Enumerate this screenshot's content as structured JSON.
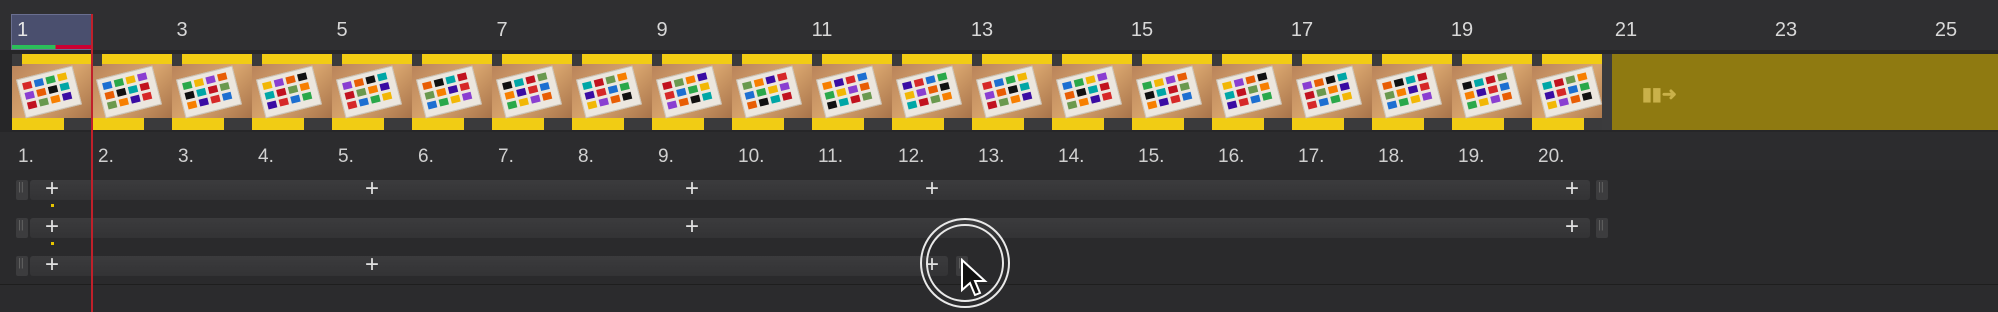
{
  "playhead": {
    "frame": "1"
  },
  "ruler": {
    "ticks": [
      "3",
      "5",
      "7",
      "9",
      "11",
      "13",
      "15",
      "17",
      "19",
      "21",
      "23",
      "25"
    ]
  },
  "clips": {
    "count": 20,
    "labels": [
      "1.",
      "2.",
      "3.",
      "4.",
      "5.",
      "6.",
      "7.",
      "8.",
      "9.",
      "10.",
      "11.",
      "12.",
      "13.",
      "14.",
      "15.",
      "16.",
      "17.",
      "18.",
      "19.",
      "20."
    ]
  },
  "empty_clip": {
    "icon": "play-next-icon"
  },
  "audio_tracks": [
    {
      "name": "audio-track-1",
      "plus_count": 5
    },
    {
      "name": "audio-track-2",
      "plus_count": 3
    },
    {
      "name": "audio-track-3",
      "plus_count": 3
    }
  ],
  "colors": {
    "clip_yellow": "#f1cc14",
    "empty_clip": "#8f7a11",
    "playhead": "#c0202a",
    "background": "#2b2b2d"
  }
}
